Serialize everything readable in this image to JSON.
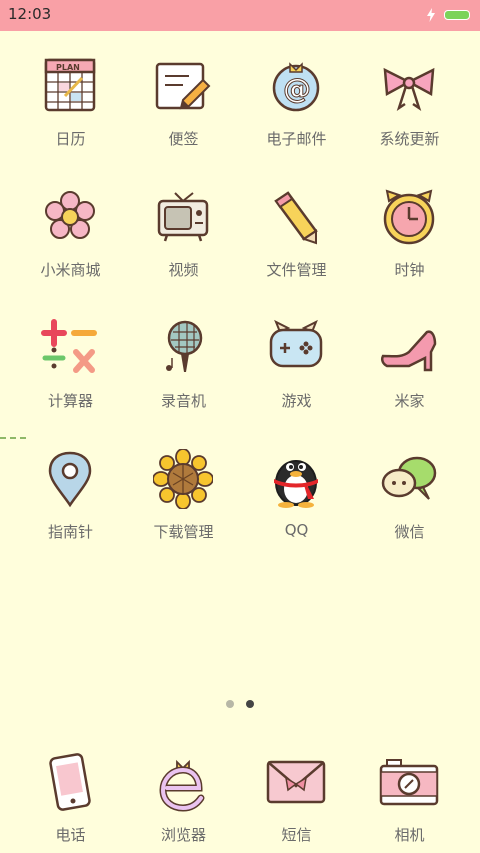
{
  "status": {
    "time": "12:03"
  },
  "colors": {
    "background": "#fffedc",
    "status_bar": "#f9a0a6",
    "label": "#6b6b6b",
    "battery": "#7bd35a"
  },
  "apps": [
    {
      "label": "日历",
      "icon": "calendar-icon"
    },
    {
      "label": "便签",
      "icon": "notes-icon"
    },
    {
      "label": "电子邮件",
      "icon": "email-icon"
    },
    {
      "label": "系统更新",
      "icon": "bow-icon"
    },
    {
      "label": "小米商城",
      "icon": "flower-icon"
    },
    {
      "label": "视频",
      "icon": "tv-icon"
    },
    {
      "label": "文件管理",
      "icon": "pencil-icon"
    },
    {
      "label": "时钟",
      "icon": "clock-icon"
    },
    {
      "label": "计算器",
      "icon": "calculator-icon"
    },
    {
      "label": "录音机",
      "icon": "microphone-icon"
    },
    {
      "label": "游戏",
      "icon": "gamepad-icon"
    },
    {
      "label": "米家",
      "icon": "high-heel-icon"
    },
    {
      "label": "指南针",
      "icon": "location-pin-icon"
    },
    {
      "label": "下载管理",
      "icon": "sunflower-icon"
    },
    {
      "label": "QQ",
      "icon": "penguin-icon"
    },
    {
      "label": "微信",
      "icon": "chat-bubbles-icon"
    }
  ],
  "page_indicator": {
    "count": 2,
    "active_index": 1
  },
  "dock": [
    {
      "label": "电话",
      "icon": "phone-icon"
    },
    {
      "label": "浏览器",
      "icon": "browser-icon"
    },
    {
      "label": "短信",
      "icon": "envelope-icon"
    },
    {
      "label": "相机",
      "icon": "camera-icon"
    }
  ],
  "plan_text": "PLAN"
}
